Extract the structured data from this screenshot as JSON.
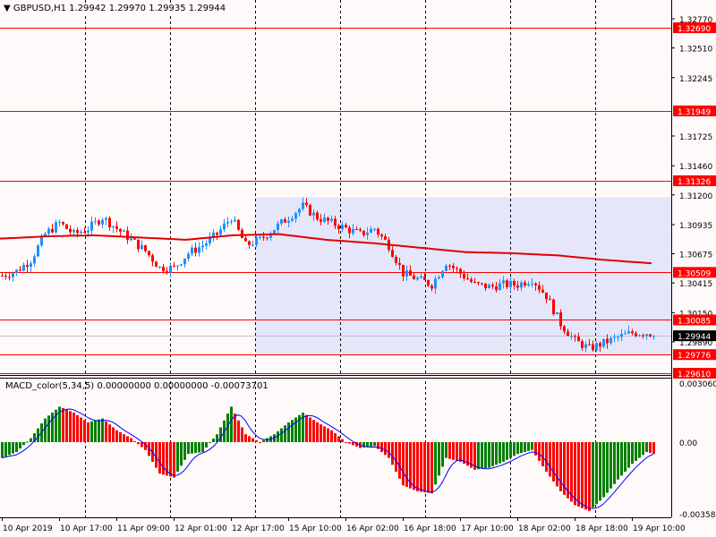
{
  "header": {
    "symbol": "GBPUSD,H1",
    "ohlc": "1.29942 1.29970 1.29935 1.29944"
  },
  "macd_header": {
    "name": "MACD_color(5,34,5)",
    "values": "0.00000000 0.00000000 -0.00073701"
  },
  "colors": {
    "background": "#fffafa",
    "bull": "#1e90ff",
    "bear": "#ff0000",
    "ma": "#e00000",
    "level": "#ff0000",
    "rect": "#e6e6fa",
    "macd_up": "#008000",
    "macd_down": "#ff0000",
    "signal": "#0000ff"
  },
  "chart_data": [
    {
      "type": "candlestick",
      "title": "GBPUSD,H1",
      "ylim": [
        1.2961,
        1.3277
      ],
      "price_ticks": [
        "1.32770",
        "1.32510",
        "1.32245",
        "1.31725",
        "1.31460",
        "1.31200",
        "1.30935",
        "1.30675",
        "1.30415",
        "1.30150",
        "1.29890"
      ],
      "levels": [
        "1.32690",
        "1.31949",
        "1.31326",
        "1.30509",
        "1.30085",
        "1.29776",
        "1.29610"
      ],
      "current_price": "1.29944",
      "rectangle": {
        "from": "12 Apr 17:00",
        "price_high": 1.3118,
        "price_low": 1.29776
      },
      "closes_h4": [
        1.3048,
        1.3052,
        1.3062,
        1.3085,
        1.3095,
        1.3085,
        1.309,
        1.31,
        1.309,
        1.308,
        1.307,
        1.3055,
        1.3055,
        1.3068,
        1.3075,
        1.3085,
        1.31,
        1.3075,
        1.308,
        1.309,
        1.31,
        1.311,
        1.31,
        1.3095,
        1.309,
        1.3085,
        1.309,
        1.3075,
        1.305,
        1.3045,
        1.304,
        1.306,
        1.305,
        1.304,
        1.3038,
        1.304,
        1.304,
        1.3045,
        1.303,
        1.3005,
        1.299,
        1.2983,
        1.2988,
        1.2993,
        1.2997,
        1.2997,
        1.29944
      ],
      "moving_average": [
        1.3081,
        1.3083,
        1.3084,
        1.3082,
        1.308,
        1.3084,
        1.3085,
        1.308,
        1.3077,
        1.3073,
        1.3069,
        1.3068,
        1.3066,
        1.3062,
        1.3059
      ]
    },
    {
      "type": "bar",
      "title": "MACD_color(5,34,5)",
      "ylim": [
        -0.003586,
        0.0030602
      ],
      "ticks": [
        "0.0030602",
        "0.00",
        "-0.003586"
      ],
      "macd_h4": [
        -0.0008,
        -0.0005,
        0.0002,
        0.0012,
        0.0018,
        0.0015,
        0.001,
        0.0012,
        0.0006,
        0.0002,
        -0.0004,
        -0.0016,
        -0.0018,
        -0.0006,
        -0.0005,
        0.0004,
        0.0018,
        0.0004,
        0.0,
        0.0004,
        0.001,
        0.0015,
        0.001,
        0.0006,
        0.0,
        -0.0003,
        -0.0002,
        -0.0008,
        -0.0022,
        -0.0025,
        -0.0026,
        -0.0008,
        -0.001,
        -0.0014,
        -0.0013,
        -0.001,
        -0.0006,
        -0.0004,
        -0.0015,
        -0.0025,
        -0.0032,
        -0.0035,
        -0.0028,
        -0.0019,
        -0.0011,
        -0.0005,
        -0.0007
      ]
    }
  ],
  "time_axis": [
    "10 Apr 2019",
    "10 Apr 17:00",
    "11 Apr 09:00",
    "12 Apr 01:00",
    "12 Apr 17:00",
    "15 Apr 10:00",
    "16 Apr 02:00",
    "16 Apr 18:00",
    "17 Apr 10:00",
    "18 Apr 02:00",
    "18 Apr 18:00",
    "19 Apr 10:00"
  ]
}
